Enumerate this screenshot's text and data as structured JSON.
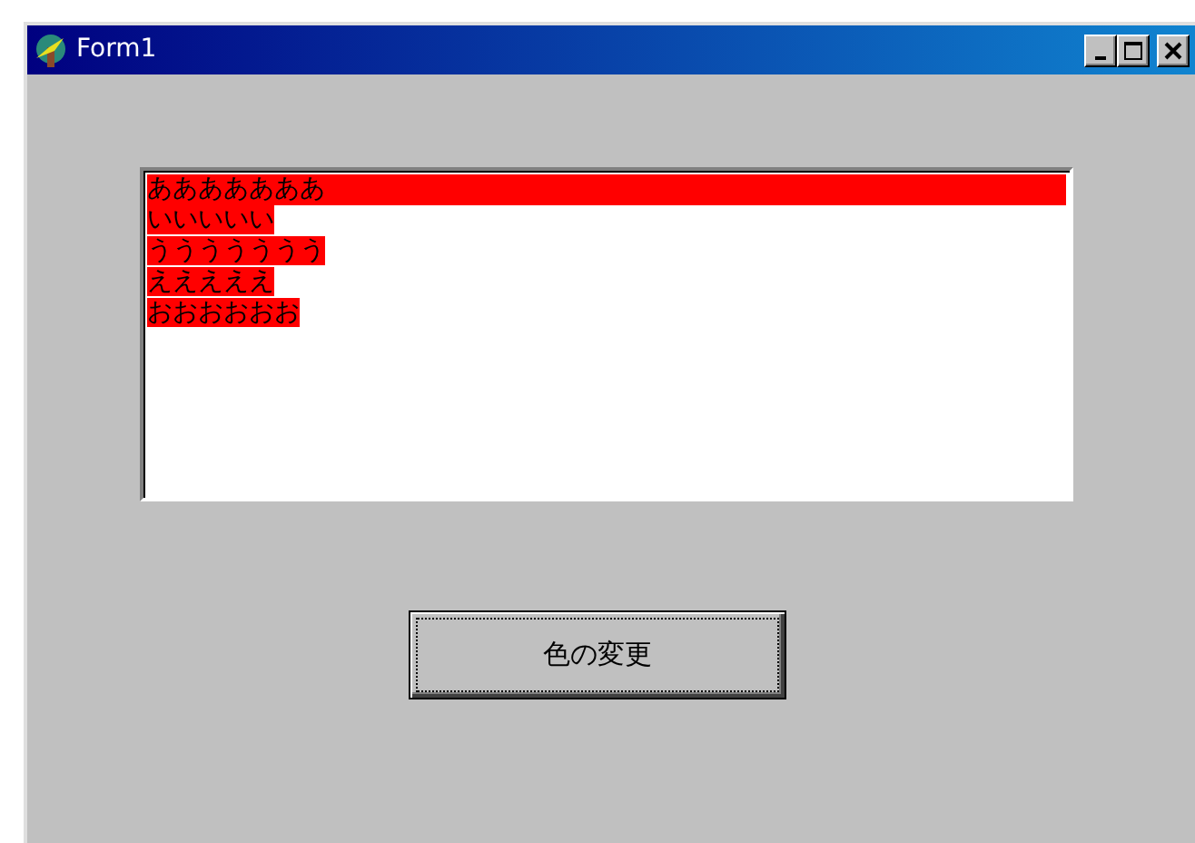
{
  "window": {
    "title": "Form1"
  },
  "list": {
    "items": [
      {
        "text": "あああああああ",
        "selected": true
      },
      {
        "text": "いいいいい",
        "selected": false
      },
      {
        "text": "ううううううう",
        "selected": false
      },
      {
        "text": "えええええ",
        "selected": false
      },
      {
        "text": "おおおおおお",
        "selected": false
      }
    ]
  },
  "button": {
    "label": "色の変更",
    "focused": true
  }
}
